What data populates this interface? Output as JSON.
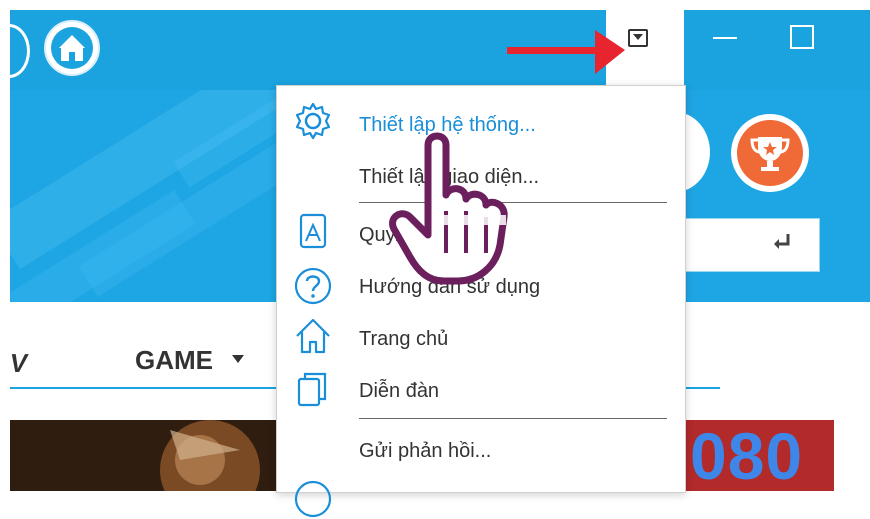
{
  "toolbar": {
    "icons": {
      "logo": "tent-logo-icon",
      "dropdown": "dropdown-menu-icon",
      "minimize": "minimize-icon",
      "maximize": "maximize-icon"
    }
  },
  "main_tabs": {
    "partial_tab": "V",
    "game_tab": "GAME",
    "game_arrow": "▼"
  },
  "promo": {
    "number": "080"
  },
  "menu": {
    "items": [
      {
        "label": "Thiết lập hệ thống...",
        "icon": "gear-icon",
        "active": true
      },
      {
        "label": "Thiết lập giao diện...",
        "icon": "",
        "active": false
      },
      {
        "label": "Quy...",
        "icon": "book-icon",
        "active": false
      },
      {
        "label": "Hướng dẫn sử dụng",
        "icon": "help-icon",
        "active": false
      },
      {
        "label": "Trang chủ",
        "icon": "home-icon",
        "active": false
      },
      {
        "label": "Diễn đàn",
        "icon": "forum-icon",
        "active": false
      },
      {
        "label": "Gửi phản hồi...",
        "icon": "",
        "active": false
      }
    ]
  },
  "colors": {
    "titlebar": "#1aa3df",
    "accent": "#1a8ed8",
    "arrow": "#e8242e",
    "hand": "#6b1f5c"
  }
}
